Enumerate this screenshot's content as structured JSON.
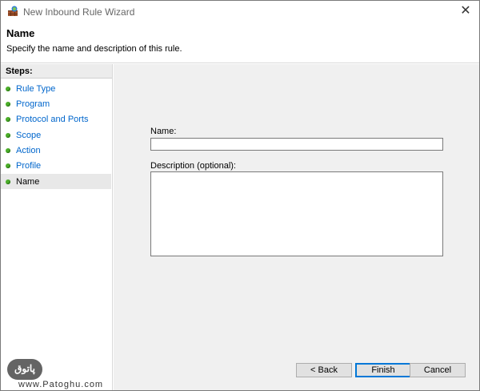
{
  "window": {
    "title": "New Inbound Rule Wizard",
    "close_glyph": "✕"
  },
  "header": {
    "title": "Name",
    "description": "Specify the name and description of this rule."
  },
  "sidebar": {
    "label": "Steps:",
    "items": [
      {
        "label": "Rule Type"
      },
      {
        "label": "Program"
      },
      {
        "label": "Protocol and Ports"
      },
      {
        "label": "Scope"
      },
      {
        "label": "Action"
      },
      {
        "label": "Profile"
      },
      {
        "label": "Name"
      }
    ]
  },
  "form": {
    "name_label": "Name:",
    "name_value": "",
    "description_label": "Description (optional):",
    "description_value": ""
  },
  "buttons": {
    "back": "< Back",
    "finish": "Finish",
    "cancel": "Cancel"
  },
  "watermark": {
    "logo_text": "ﭘﺎﺗﻮق",
    "url": "www.Patoghu.com"
  },
  "colors": {
    "step_link": "#0066cc",
    "step_dot": "#4caf2a",
    "content_bg": "#f0f0f0",
    "accent": "#0078d7"
  }
}
